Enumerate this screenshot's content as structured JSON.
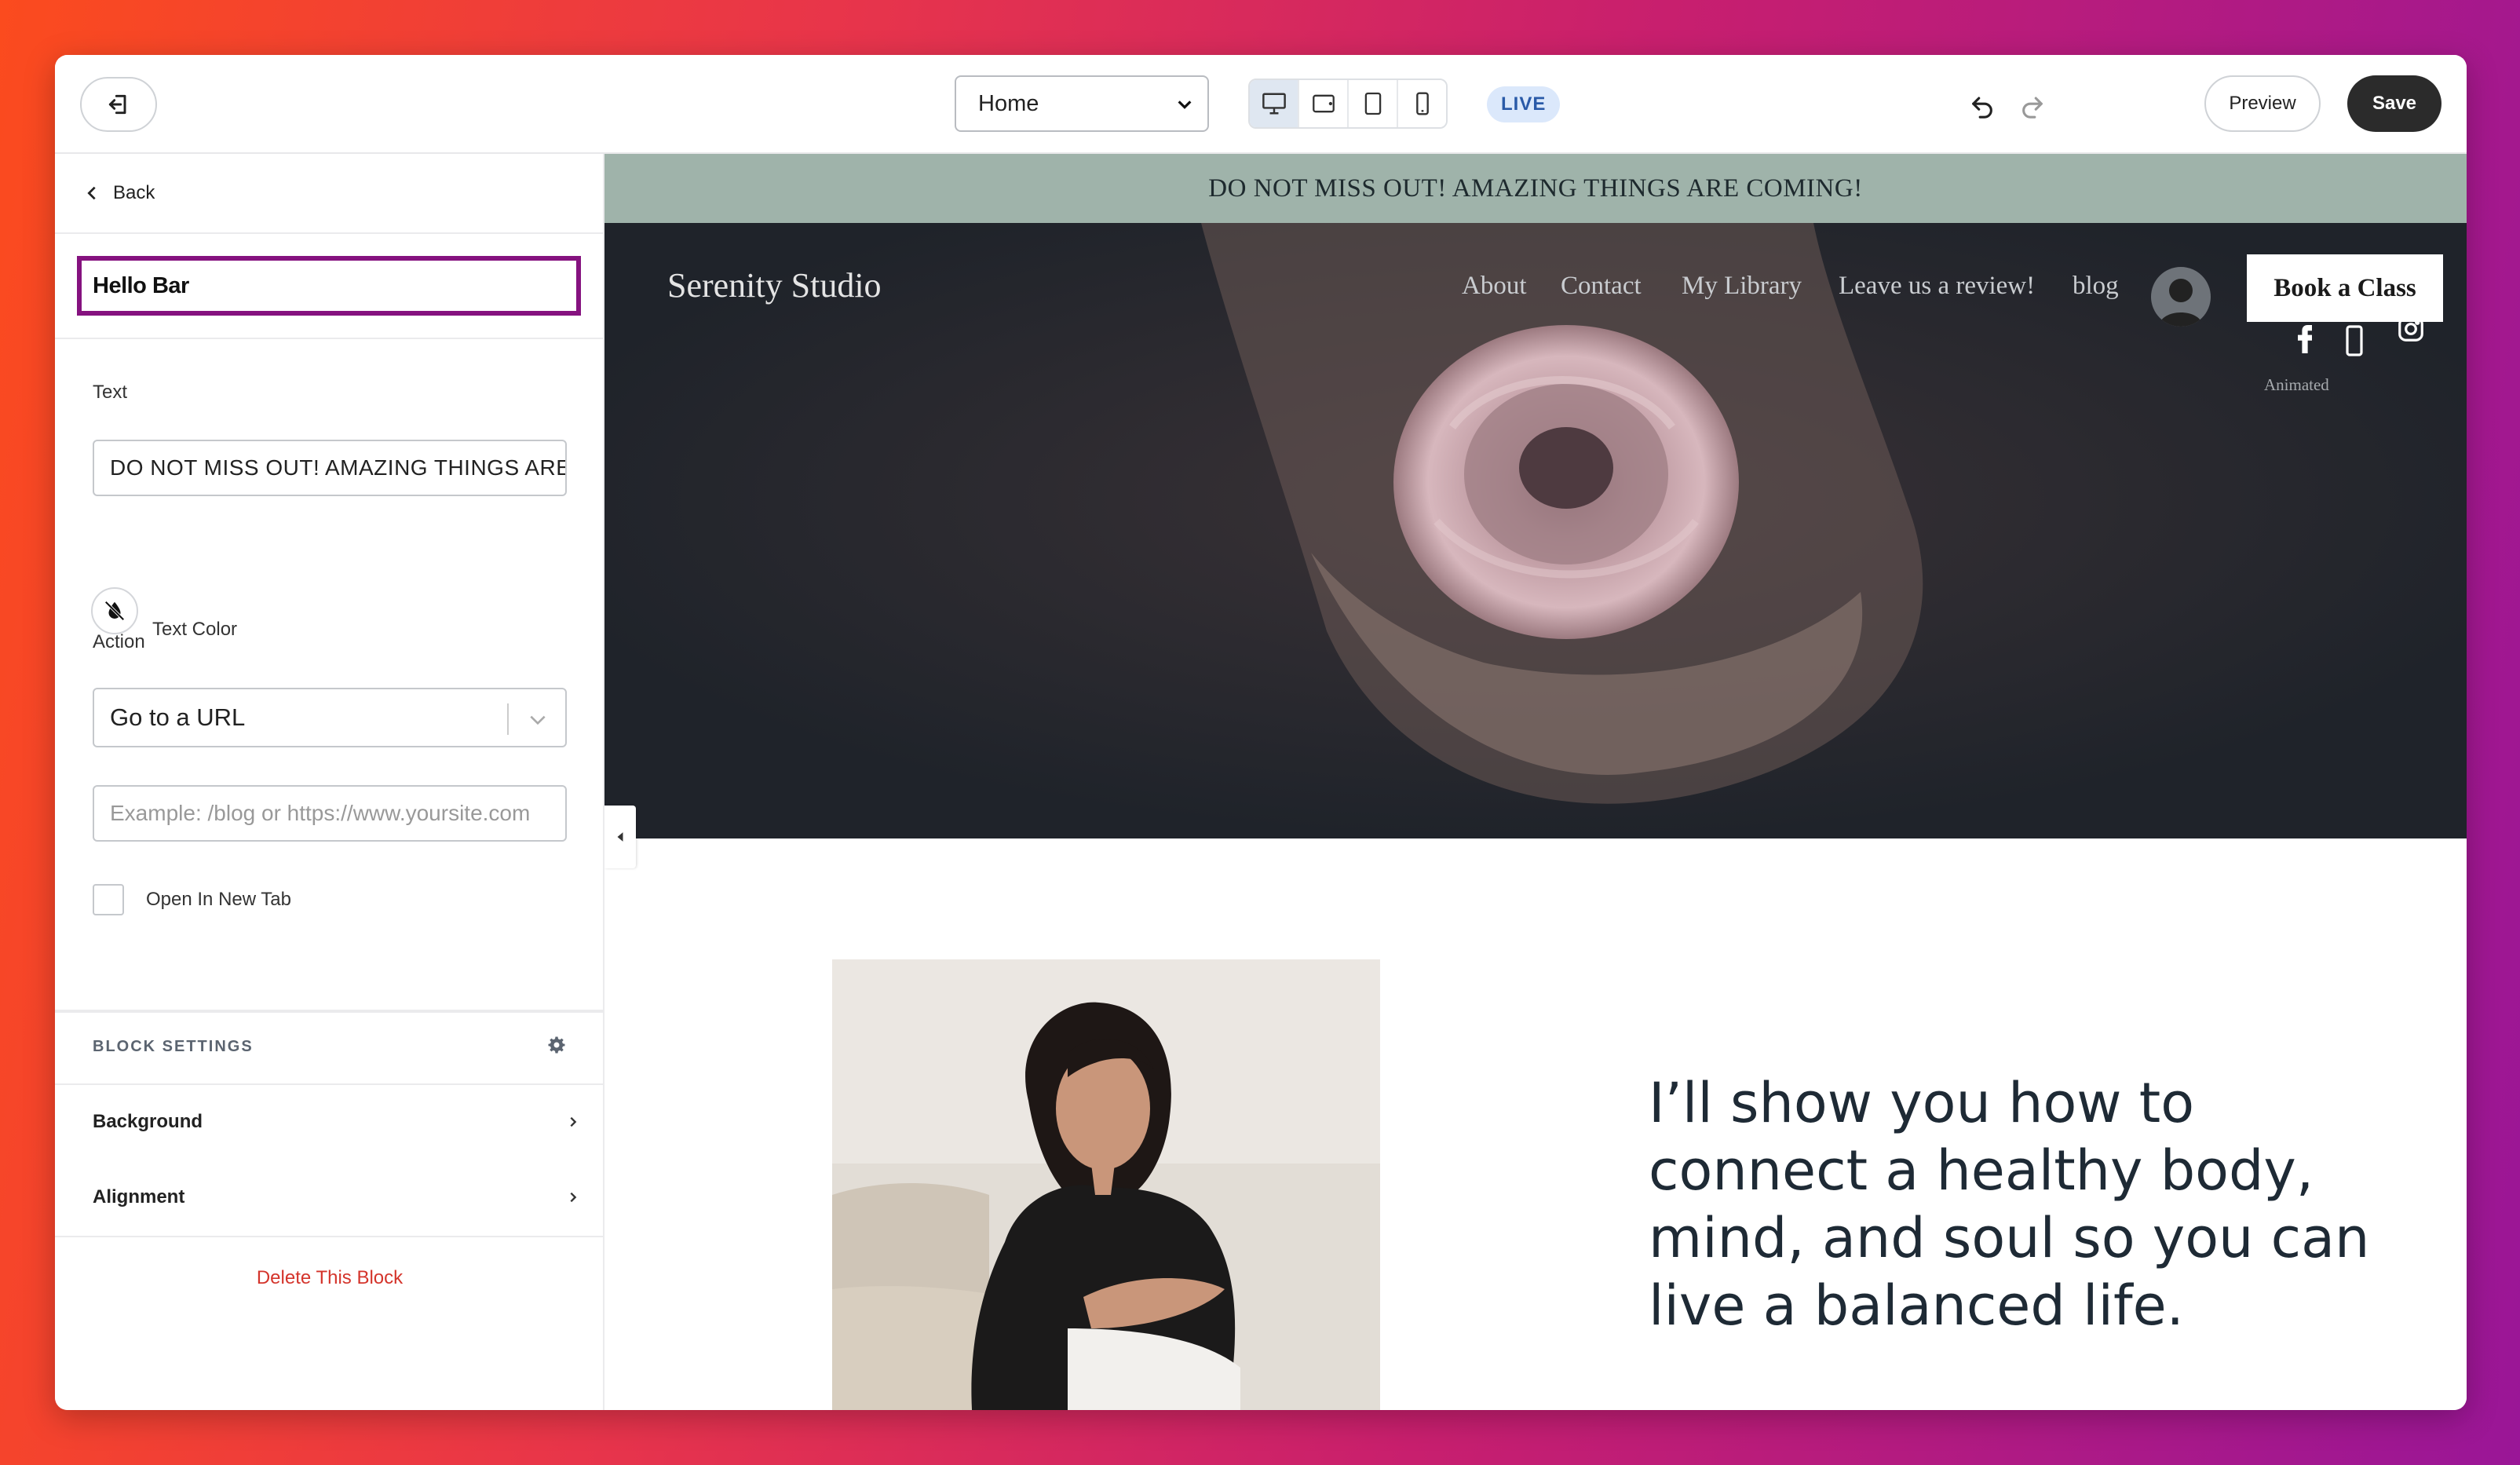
{
  "toolbar": {
    "page_select_value": "Home",
    "live_badge": "LIVE",
    "preview_label": "Preview",
    "save_label": "Save"
  },
  "sidebar": {
    "back_label": "Back",
    "block_title": "Hello Bar",
    "text_label": "Text",
    "text_value": "DO NOT MISS OUT! AMAZING THINGS ARE COMING!",
    "text_color_label": "Text Color",
    "action_label": "Action",
    "action_value": "Go to a URL",
    "url_placeholder": "Example: /blog or https://www.yoursite.com",
    "open_new_tab_label": "Open In New Tab",
    "block_settings_label": "BLOCK SETTINGS",
    "background_label": "Background",
    "alignment_label": "Alignment",
    "delete_label": "Delete This Block"
  },
  "site": {
    "hello_bar_text": "DO NOT MISS OUT! AMAZING THINGS ARE COMING!",
    "title": "Serenity Studio",
    "nav": [
      "About",
      "Contact",
      "My Library",
      "Leave us a review!",
      "blog"
    ],
    "book_button": "Book a Class",
    "animated_label": "Animated",
    "headline": "I’ll show you how to connect a healthy body, mind, and soul so you can live a balanced life."
  },
  "colors": {
    "accent_outline": "#85127f",
    "hello_bar_bg": "#9fb3aa",
    "hero_bg": "#1f232a",
    "delete_red": "#d4342b",
    "save_bg": "#2b2b2b"
  },
  "icons": {
    "exit": "exit-editor-icon",
    "desktop": "desktop-icon",
    "tablet_landscape": "tablet-landscape-icon",
    "tablet_portrait": "tablet-portrait-icon",
    "mobile": "mobile-icon",
    "undo": "undo-icon",
    "redo": "redo-icon",
    "back": "chevron-left-icon",
    "text_color": "no-color-icon",
    "settings": "gear-icon"
  }
}
